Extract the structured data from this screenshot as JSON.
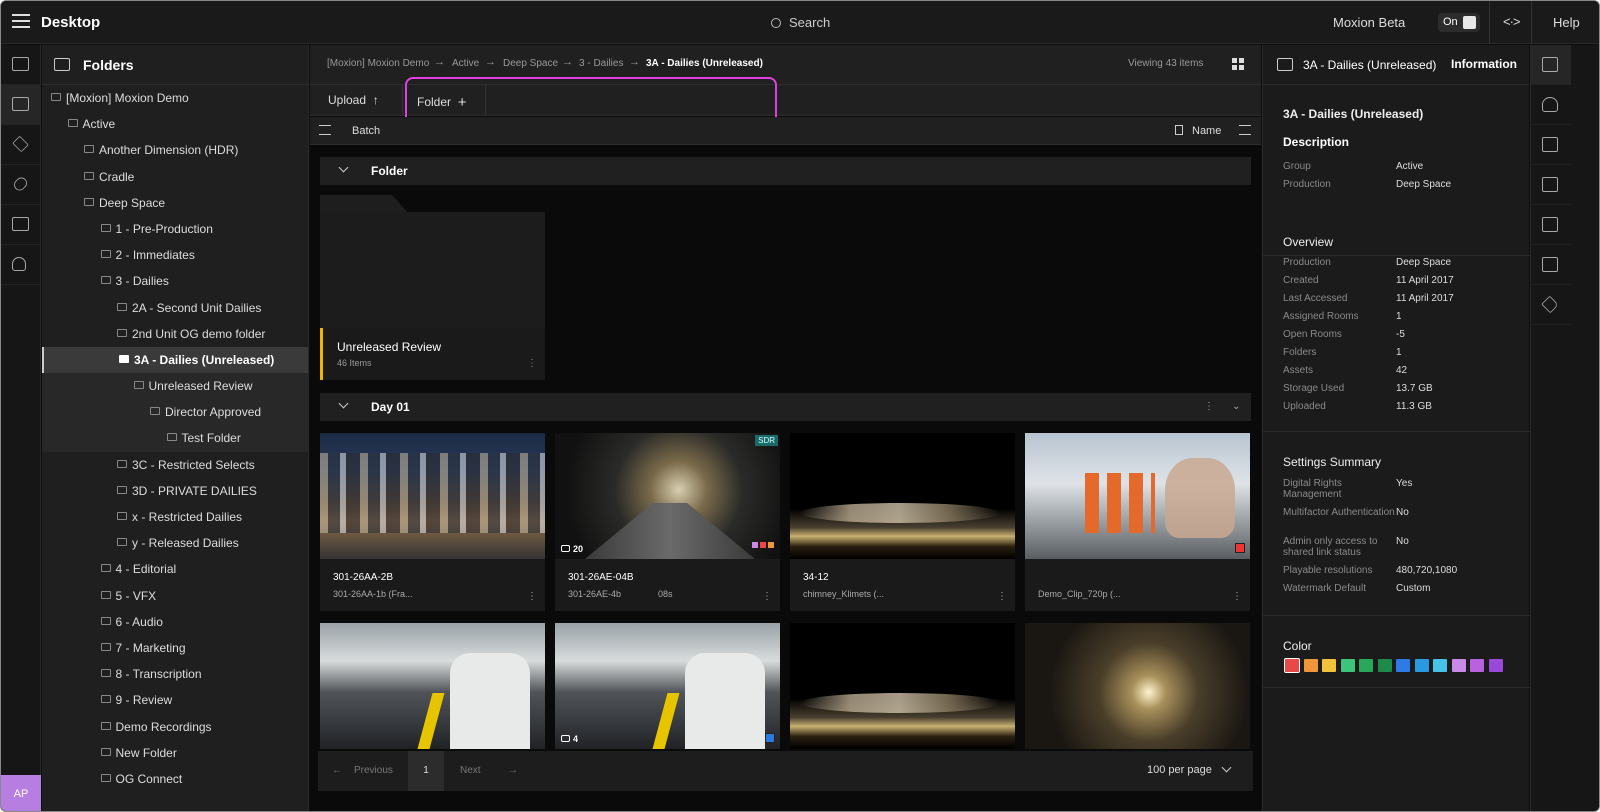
{
  "topbar": {
    "title": "Desktop",
    "search_label": "Search",
    "beta_label": "Moxion Beta",
    "toggle_label": "On",
    "code_icon": "<·>",
    "help_label": "Help"
  },
  "rail": {
    "avatar_initials": "AP"
  },
  "folders": {
    "title": "Folders",
    "items": [
      {
        "label": "[Moxion] Moxion Demo",
        "depth": 0
      },
      {
        "label": "Active",
        "depth": 1
      },
      {
        "label": "Another Dimension (HDR)",
        "depth": 2
      },
      {
        "label": "Cradle",
        "depth": 2
      },
      {
        "label": "Deep Space",
        "depth": 2
      },
      {
        "label": "1 - Pre-Production",
        "depth": 3
      },
      {
        "label": "2 - Immediates",
        "depth": 3
      },
      {
        "label": "3 - Dailies",
        "depth": 3
      },
      {
        "label": "2A - Second Unit Dailies",
        "depth": 4
      },
      {
        "label": "2nd Unit OG demo folder",
        "depth": 4
      },
      {
        "label": "3A - Dailies (Unreleased)",
        "depth": 4,
        "selected": true
      },
      {
        "label": "Unreleased Review",
        "depth": 5,
        "sub": true
      },
      {
        "label": "Director Approved",
        "depth": 6,
        "sub": true
      },
      {
        "label": "Test Folder",
        "depth": 7,
        "sub": true
      },
      {
        "label": "3C - Restricted Selects",
        "depth": 4
      },
      {
        "label": "3D - PRIVATE DAILIES",
        "depth": 4
      },
      {
        "label": "x - Restricted Dailies",
        "depth": 4
      },
      {
        "label": "y - Released Dailies",
        "depth": 4
      },
      {
        "label": "4 - Editorial",
        "depth": 3
      },
      {
        "label": "5 - VFX",
        "depth": 3
      },
      {
        "label": "6 - Audio",
        "depth": 3
      },
      {
        "label": "7 - Marketing",
        "depth": 3
      },
      {
        "label": "8 - Transcription",
        "depth": 3
      },
      {
        "label": "9 - Review",
        "depth": 3
      },
      {
        "label": "Demo Recordings",
        "depth": 3
      },
      {
        "label": "New Folder",
        "depth": 3
      },
      {
        "label": "OG Connect",
        "depth": 3
      }
    ]
  },
  "breadcrumb": {
    "items": [
      "[Moxion] Moxion Demo",
      "Active",
      "Deep Space",
      "3 - Dailies",
      "3A - Dailies (Unreleased)"
    ],
    "viewing": "Viewing 43 items"
  },
  "actions": {
    "upload_label": "Upload",
    "upload_icon": "↑",
    "folder_label": "Folder",
    "folder_icon": "+",
    "batch_label": "Batch",
    "sort_label": "Name"
  },
  "sections": {
    "folder_header": "Folder",
    "day_header": "Day 01"
  },
  "folder_card": {
    "name": "Unreleased Review",
    "count": "46 Items",
    "accent": "#f0b400"
  },
  "assets": [
    {
      "name": "301-26AA-2B",
      "sub": "301-26AA-1b (Fra...",
      "thumb": "city"
    },
    {
      "name": "301-26AE-04B",
      "sub": "301-26AE-4b",
      "duration": "08s",
      "comments": "20",
      "badge": "SDR",
      "thumb": "tunnel"
    },
    {
      "name": "34-12",
      "sub": "chimney_Klimets (...",
      "thumb": "night"
    },
    {
      "name": "",
      "sub": "Demo_Clip_720p (...",
      "thumb": "astro"
    },
    {
      "thumb": "train"
    },
    {
      "thumb": "train",
      "comments": "4"
    },
    {
      "thumb": "night"
    },
    {
      "thumb": "tunnel2"
    }
  ],
  "pager": {
    "previous": "Previous",
    "page": "1",
    "next": "Next",
    "per_page": "100 per page"
  },
  "info": {
    "header_title": "3A - Dailies (Unreleased)",
    "header_tab": "Information",
    "name": "3A - Dailies (Unreleased)",
    "description_title": "Description",
    "description": [
      {
        "k": "Group",
        "v": "Active"
      },
      {
        "k": "Production",
        "v": "Deep Space"
      }
    ],
    "overview_title": "Overview",
    "overview": [
      {
        "k": "Production",
        "v": "Deep Space"
      },
      {
        "k": "Created",
        "v": "11 April 2017"
      },
      {
        "k": "Last Accessed",
        "v": "11 April 2017"
      },
      {
        "k": "Assigned Rooms",
        "v": "1"
      },
      {
        "k": "Open Rooms",
        "v": "-5"
      },
      {
        "k": "Folders",
        "v": "1"
      },
      {
        "k": "Assets",
        "v": "42"
      },
      {
        "k": "Storage Used",
        "v": "13.7 GB"
      },
      {
        "k": "Uploaded",
        "v": "11.3 GB"
      }
    ],
    "settings_title": "Settings Summary",
    "settings": [
      {
        "k": "Digital Rights Management",
        "v": "Yes"
      },
      {
        "k": "Multifactor Authentication",
        "v": "No"
      },
      {
        "k": "Admin only access to shared link status",
        "v": "No"
      },
      {
        "k": "Playable resolutions",
        "v": "480,720,1080"
      },
      {
        "k": "Watermark Default",
        "v": "Custom"
      }
    ],
    "color_title": "Color",
    "colors": [
      "#e94848",
      "#f0963a",
      "#f2c23a",
      "#3fc27a",
      "#2aa85a",
      "#1e8a4a",
      "#2e7ae6",
      "#2a9ae0",
      "#46c2e6",
      "#c88ae6",
      "#b862e0",
      "#9a48d8"
    ]
  },
  "icons": {
    "rail": [
      "inbox-icon",
      "desktop-icon",
      "layers-icon",
      "link-icon",
      "database-icon",
      "user-settings-icon"
    ],
    "right_rail": [
      "info-icon",
      "person-icon",
      "lock-icon",
      "playback-settings-icon",
      "transfer-icon",
      "sliders-icon",
      "tag-icon"
    ]
  }
}
